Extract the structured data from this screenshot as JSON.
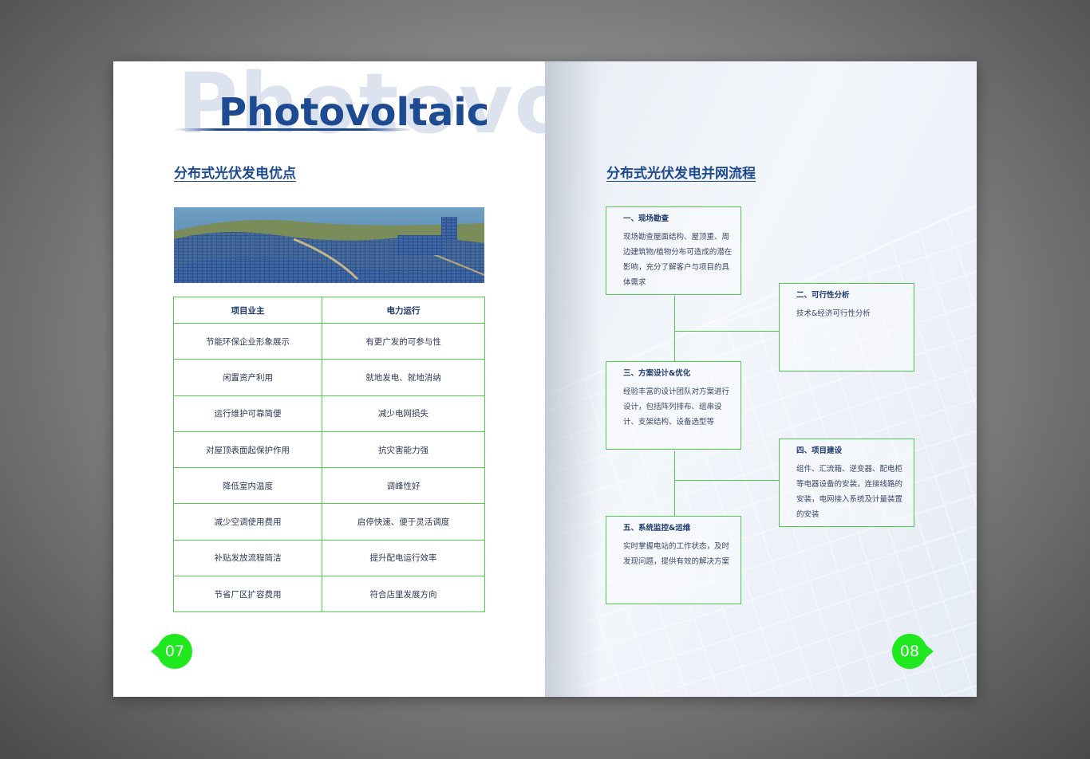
{
  "watermark": "Photovoltaic",
  "title": "Photovoltaic",
  "left_page": {
    "section_title": "分布式光伏发电优点",
    "table": {
      "headers": [
        "项目业主",
        "电力运行"
      ],
      "rows": [
        [
          "节能环保企业形象展示",
          "有更广发的可参与性"
        ],
        [
          "闲置资产利用",
          "就地发电、就地消纳"
        ],
        [
          "运行维护可靠简便",
          "减少电网损失"
        ],
        [
          "对屋顶表面起保护作用",
          "抗灾害能力强"
        ],
        [
          "降低室内温度",
          "调峰性好"
        ],
        [
          "减少空调使用费用",
          "启停快速、便于灵活调度"
        ],
        [
          "补贴发放流程简洁",
          "提升配电运行效率"
        ],
        [
          "节省厂区扩容费用",
          "符合店里发展方向"
        ]
      ]
    },
    "page_number": "07"
  },
  "right_page": {
    "section_title": "分布式光伏发电并网流程",
    "steps": [
      {
        "title": "一、现场勘查",
        "body": "现场勘查屋面结构、屋顶重、周边建筑物/植物分布可造成的潜在影响，充分了解客户与项目的具体需求"
      },
      {
        "title": "二、可行性分析",
        "body": "技术&经济可行性分析"
      },
      {
        "title": "三、方案设计&优化",
        "body": "经验丰富的设计团队对方案进行设计，包括阵列排布、组串设计、支架结构、设备选型等"
      },
      {
        "title": "四、项目建设",
        "body": "组件、汇流箱、逆变器、配电柜等电器设备的安装，连接线路的安装，电网接入系统及计量装置的安装"
      },
      {
        "title": "五、系统监控&运维",
        "body": "实时掌握电站的工作状态，及时发现问题，提供有效的解决方案"
      }
    ],
    "page_number": "08"
  },
  "colors": {
    "brand_blue": "#1e4a92",
    "accent_green": "#1fe81f",
    "border_green": "#4fd14f"
  }
}
